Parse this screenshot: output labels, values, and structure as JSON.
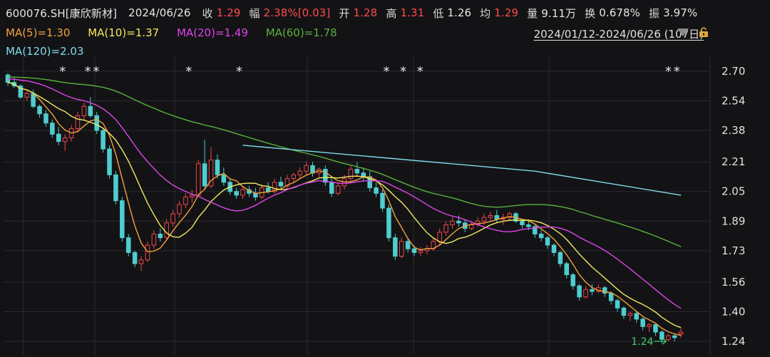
{
  "header": {
    "symbol": "600076.SH[康欣新材]",
    "date": "2024/06/26",
    "close_label": "收",
    "close": "1.29",
    "change_label": "幅",
    "change": "2.38%[0.03]",
    "open_label": "开",
    "open": "1.28",
    "high_label": "高",
    "high": "1.31",
    "low_label": "低",
    "low": "1.26",
    "avg_label": "均",
    "avg": "1.29",
    "volume_label": "量",
    "volume": "9.11万",
    "turnover_label": "换",
    "turnover": "0.678%",
    "amplitude_label": "振",
    "amplitude": "3.97%"
  },
  "ma_labels": {
    "ma5": "MA(5)=1.30",
    "ma10": "MA(10)=1.37",
    "ma20": "MA(20)=1.49",
    "ma60": "MA(60)=1.78",
    "ma120": "MA(120)=2.03"
  },
  "range_label": "2024/01/12-2024/06/26 (107日)",
  "colors": {
    "up": "#f04848",
    "down": "#4ecdcf",
    "ma5": "#f3a13c",
    "ma10": "#f1ea5f",
    "ma20": "#dd46e8",
    "ma60": "#58b23a",
    "ma120": "#7fdcea",
    "axis_text": "#e0e0e0",
    "grid": "#2b2b30",
    "annotation": "#3fcf6a"
  },
  "icons": {
    "dropdown": "triangle-down-icon",
    "lock": "lock-icon"
  },
  "chart_data": {
    "type": "candlestick",
    "title": "600076.SH 康欣新材 日K",
    "y_ticks": [
      "2.70",
      "2.54",
      "2.38",
      "2.21",
      "2.05",
      "1.89",
      "1.73",
      "1.56",
      "1.40",
      "1.24"
    ],
    "ylim": [
      1.19,
      2.74
    ],
    "grid": true,
    "n_days": 107,
    "star_markers": [
      13,
      19,
      21,
      43,
      55,
      90,
      94,
      98,
      157,
      159
    ],
    "low_annotation": {
      "text": "1.24",
      "index": 104,
      "value": 1.24
    },
    "ohlc": [
      [
        2.68,
        2.69,
        2.62,
        2.64
      ],
      [
        2.64,
        2.67,
        2.61,
        2.62
      ],
      [
        2.62,
        2.63,
        2.55,
        2.56
      ],
      [
        2.56,
        2.6,
        2.54,
        2.58
      ],
      [
        2.58,
        2.6,
        2.5,
        2.51
      ],
      [
        2.51,
        2.52,
        2.45,
        2.47
      ],
      [
        2.47,
        2.49,
        2.4,
        2.42
      ],
      [
        2.42,
        2.44,
        2.34,
        2.36
      ],
      [
        2.36,
        2.4,
        2.3,
        2.32
      ],
      [
        2.32,
        2.36,
        2.27,
        2.34
      ],
      [
        2.34,
        2.41,
        2.32,
        2.39
      ],
      [
        2.39,
        2.48,
        2.37,
        2.46
      ],
      [
        2.46,
        2.53,
        2.44,
        2.51
      ],
      [
        2.51,
        2.56,
        2.45,
        2.46
      ],
      [
        2.46,
        2.48,
        2.36,
        2.38
      ],
      [
        2.38,
        2.39,
        2.26,
        2.28
      ],
      [
        2.28,
        2.3,
        2.12,
        2.14
      ],
      [
        2.14,
        2.16,
        1.98,
        2.0
      ],
      [
        2.0,
        2.02,
        1.78,
        1.8
      ],
      [
        1.8,
        1.82,
        1.7,
        1.72
      ],
      [
        1.72,
        1.73,
        1.64,
        1.66
      ],
      [
        1.66,
        1.7,
        1.62,
        1.68
      ],
      [
        1.68,
        1.78,
        1.67,
        1.76
      ],
      [
        1.76,
        1.84,
        1.74,
        1.82
      ],
      [
        1.82,
        1.85,
        1.78,
        1.8
      ],
      [
        1.8,
        1.9,
        1.79,
        1.88
      ],
      [
        1.88,
        1.95,
        1.86,
        1.93
      ],
      [
        1.93,
        2.0,
        1.91,
        1.98
      ],
      [
        1.98,
        2.04,
        1.96,
        2.02
      ],
      [
        2.02,
        2.06,
        1.99,
        2.03
      ],
      [
        2.03,
        2.22,
        2.02,
        2.2
      ],
      [
        2.2,
        2.33,
        2.06,
        2.08
      ],
      [
        2.08,
        2.29,
        2.07,
        2.22
      ],
      [
        2.22,
        2.25,
        2.12,
        2.14
      ],
      [
        2.14,
        2.18,
        2.08,
        2.1
      ],
      [
        2.1,
        2.12,
        2.03,
        2.05
      ],
      [
        2.05,
        2.07,
        2.01,
        2.03
      ],
      [
        2.03,
        2.08,
        2.01,
        2.06
      ],
      [
        2.06,
        2.08,
        2.02,
        2.04
      ],
      [
        2.04,
        2.07,
        2.0,
        2.02
      ],
      [
        2.02,
        2.09,
        2.01,
        2.07
      ],
      [
        2.07,
        2.1,
        2.04,
        2.05
      ],
      [
        2.05,
        2.12,
        2.04,
        2.1
      ],
      [
        2.1,
        2.13,
        2.07,
        2.08
      ],
      [
        2.08,
        2.14,
        2.06,
        2.12
      ],
      [
        2.12,
        2.15,
        2.1,
        2.14
      ],
      [
        2.14,
        2.18,
        2.12,
        2.16
      ],
      [
        2.16,
        2.21,
        2.14,
        2.19
      ],
      [
        2.19,
        2.21,
        2.13,
        2.15
      ],
      [
        2.15,
        2.18,
        2.12,
        2.17
      ],
      [
        2.17,
        2.19,
        2.08,
        2.1
      ],
      [
        2.1,
        2.12,
        2.02,
        2.04
      ],
      [
        2.04,
        2.1,
        2.03,
        2.08
      ],
      [
        2.08,
        2.14,
        2.06,
        2.12
      ],
      [
        2.12,
        2.19,
        2.1,
        2.17
      ],
      [
        2.17,
        2.21,
        2.13,
        2.15
      ],
      [
        2.15,
        2.18,
        2.11,
        2.13
      ],
      [
        2.13,
        2.16,
        2.05,
        2.07
      ],
      [
        2.07,
        2.1,
        2.02,
        2.04
      ],
      [
        2.04,
        2.06,
        1.94,
        1.96
      ],
      [
        1.96,
        1.98,
        1.78,
        1.8
      ],
      [
        1.8,
        1.82,
        1.68,
        1.7
      ],
      [
        1.7,
        1.8,
        1.69,
        1.78
      ],
      [
        1.78,
        1.8,
        1.72,
        1.74
      ],
      [
        1.74,
        1.76,
        1.7,
        1.72
      ],
      [
        1.72,
        1.75,
        1.7,
        1.73
      ],
      [
        1.73,
        1.76,
        1.71,
        1.74
      ],
      [
        1.74,
        1.8,
        1.73,
        1.78
      ],
      [
        1.78,
        1.85,
        1.76,
        1.83
      ],
      [
        1.83,
        1.89,
        1.81,
        1.87
      ],
      [
        1.87,
        1.91,
        1.85,
        1.89
      ],
      [
        1.89,
        1.92,
        1.86,
        1.88
      ],
      [
        1.88,
        1.9,
        1.83,
        1.85
      ],
      [
        1.85,
        1.89,
        1.84,
        1.87
      ],
      [
        1.87,
        1.91,
        1.86,
        1.89
      ],
      [
        1.89,
        1.93,
        1.87,
        1.91
      ],
      [
        1.91,
        1.94,
        1.89,
        1.92
      ],
      [
        1.92,
        1.95,
        1.88,
        1.9
      ],
      [
        1.9,
        1.93,
        1.87,
        1.91
      ],
      [
        1.91,
        1.94,
        1.89,
        1.93
      ],
      [
        1.93,
        1.94,
        1.88,
        1.89
      ],
      [
        1.89,
        1.9,
        1.85,
        1.87
      ],
      [
        1.87,
        1.89,
        1.84,
        1.86
      ],
      [
        1.86,
        1.87,
        1.8,
        1.82
      ],
      [
        1.82,
        1.84,
        1.78,
        1.8
      ],
      [
        1.8,
        1.81,
        1.74,
        1.76
      ],
      [
        1.76,
        1.77,
        1.7,
        1.72
      ],
      [
        1.72,
        1.73,
        1.64,
        1.66
      ],
      [
        1.66,
        1.67,
        1.58,
        1.6
      ],
      [
        1.6,
        1.61,
        1.52,
        1.54
      ],
      [
        1.54,
        1.55,
        1.46,
        1.48
      ],
      [
        1.48,
        1.54,
        1.47,
        1.52
      ],
      [
        1.52,
        1.55,
        1.49,
        1.51
      ],
      [
        1.51,
        1.55,
        1.5,
        1.53
      ],
      [
        1.53,
        1.54,
        1.48,
        1.5
      ],
      [
        1.5,
        1.51,
        1.44,
        1.46
      ],
      [
        1.46,
        1.47,
        1.4,
        1.42
      ],
      [
        1.42,
        1.43,
        1.36,
        1.38
      ],
      [
        1.38,
        1.4,
        1.35,
        1.39
      ],
      [
        1.39,
        1.4,
        1.34,
        1.36
      ],
      [
        1.36,
        1.37,
        1.3,
        1.32
      ],
      [
        1.32,
        1.34,
        1.29,
        1.33
      ],
      [
        1.33,
        1.34,
        1.27,
        1.29
      ],
      [
        1.29,
        1.3,
        1.23,
        1.25
      ],
      [
        1.25,
        1.28,
        1.24,
        1.27
      ],
      [
        1.27,
        1.28,
        1.24,
        1.26
      ],
      [
        1.28,
        1.31,
        1.26,
        1.29
      ]
    ],
    "ma120_segment": {
      "from_index": 37,
      "values": [
        2.3,
        2.23,
        2.16,
        2.03
      ]
    }
  }
}
